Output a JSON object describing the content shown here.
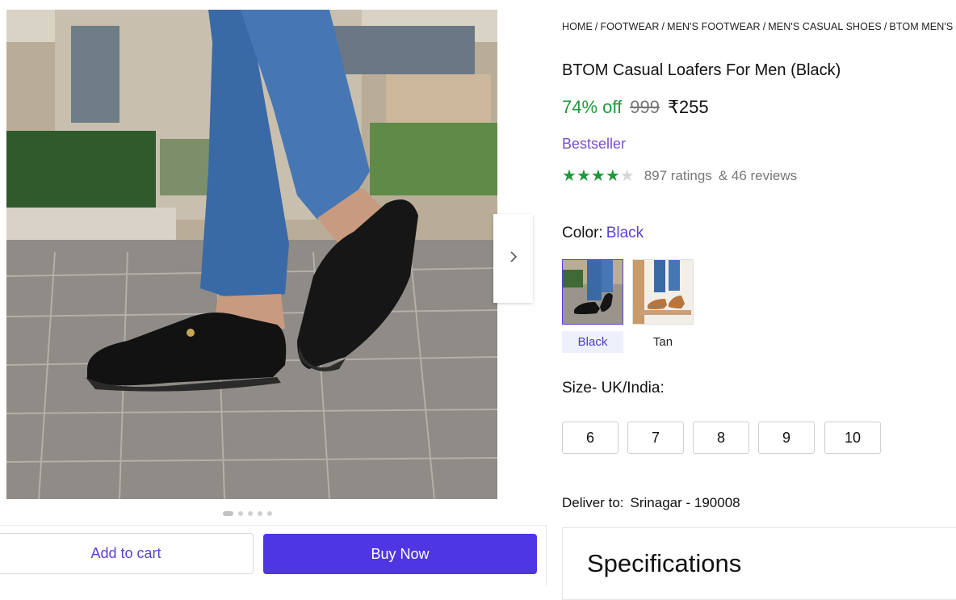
{
  "breadcrumb": [
    "HOME",
    "FOOTWEAR",
    "MEN'S FOOTWEAR",
    "MEN'S CASUAL SHOES",
    "BTOM MEN'S C"
  ],
  "product": {
    "title": "BTOM Casual Loafers For Men (Black)",
    "discount": "74% off",
    "mrp": "999",
    "price": "₹255",
    "badge": "Bestseller",
    "rating": 4,
    "rating_max": 5,
    "ratings_count": "897 ratings",
    "reviews_count": "& 46 reviews"
  },
  "color": {
    "label": "Color:",
    "selected": "Black",
    "options": [
      "Black",
      "Tan"
    ]
  },
  "size": {
    "label": "Size- UK/India:",
    "options": [
      "6",
      "7",
      "8",
      "9",
      "10"
    ]
  },
  "delivery": {
    "label": "Deliver to:",
    "location": "Srinagar - 190008"
  },
  "specifications": {
    "title": "Specifications"
  },
  "gallery": {
    "image_count": 5,
    "active_index": 0
  },
  "actions": {
    "add_to_cart": "Add to cart",
    "buy_now": "Buy Now"
  },
  "colors": {
    "accent": "#4f36e3",
    "discount": "#1e9a3c",
    "badge": "#7a4fc9",
    "stars": "#1e9a3c"
  },
  "icons": {
    "next": "chevron-right-icon",
    "star": "star-icon"
  }
}
